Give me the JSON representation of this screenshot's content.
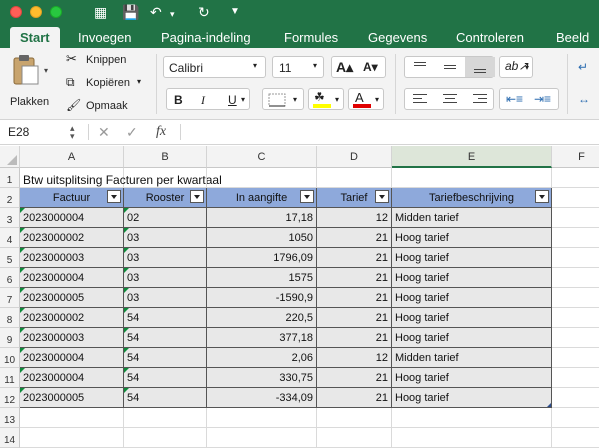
{
  "ribbon_tabs": [
    "Start",
    "Invoegen",
    "Pagina-indeling",
    "Formules",
    "Gegevens",
    "Controleren",
    "Beeld"
  ],
  "clipboard": {
    "paste": "Plakken",
    "cut": "Knippen",
    "copy": "Kopiëren",
    "format": "Opmaak"
  },
  "font": {
    "name": "Calibri",
    "size": "11",
    "bold": "B",
    "italic": "I",
    "underline": "U"
  },
  "formula_bar": {
    "cell_ref": "E28",
    "fx": "fx",
    "content": ""
  },
  "columns": [
    "A",
    "B",
    "C",
    "D",
    "E",
    "F"
  ],
  "rows": [
    "1",
    "2",
    "3",
    "4",
    "5",
    "6",
    "7",
    "8",
    "9",
    "10",
    "11",
    "12",
    "13",
    "14"
  ],
  "sheet_title": "Btw uitsplitsing Facturen per kwartaal",
  "table": {
    "headers": [
      "Factuur",
      "Rooster",
      "In aangifte",
      "Tarief",
      "Tariefbeschrijving"
    ],
    "rows": [
      [
        "2023000004",
        "02",
        "17,18",
        "12",
        "Midden tarief"
      ],
      [
        "2023000002",
        "03",
        "1050",
        "21",
        "Hoog tarief"
      ],
      [
        "2023000003",
        "03",
        "1796,09",
        "21",
        "Hoog tarief"
      ],
      [
        "2023000004",
        "03",
        "1575",
        "21",
        "Hoog tarief"
      ],
      [
        "2023000005",
        "03",
        "-1590,9",
        "21",
        "Hoog tarief"
      ],
      [
        "2023000002",
        "54",
        "220,5",
        "21",
        "Hoog tarief"
      ],
      [
        "2023000003",
        "54",
        "377,18",
        "21",
        "Hoog tarief"
      ],
      [
        "2023000004",
        "54",
        "2,06",
        "12",
        "Midden tarief"
      ],
      [
        "2023000004",
        "54",
        "330,75",
        "21",
        "Hoog tarief"
      ],
      [
        "2023000005",
        "54",
        "-334,09",
        "21",
        "Hoog tarief"
      ]
    ]
  },
  "colors": {
    "accent": "#217346",
    "table_header": "#8ea9db",
    "table_body": "#e8e8e8"
  }
}
